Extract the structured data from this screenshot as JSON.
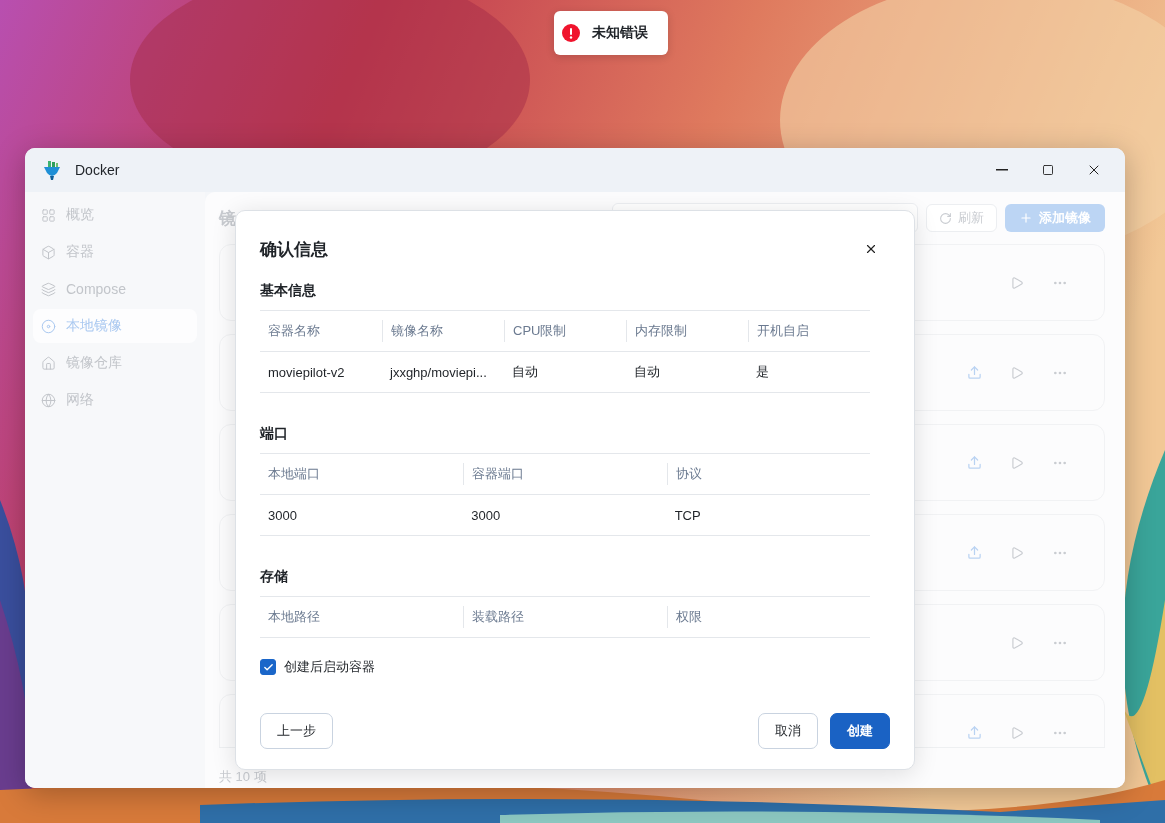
{
  "toast": {
    "kind": "error",
    "message": "未知错误"
  },
  "window": {
    "title": "Docker"
  },
  "sidebar": {
    "items": [
      {
        "label": "概览",
        "selected": false
      },
      {
        "label": "容器",
        "selected": false
      },
      {
        "label": "Compose",
        "selected": false
      },
      {
        "label": "本地镜像",
        "selected": true
      },
      {
        "label": "镜像仓库",
        "selected": false
      },
      {
        "label": "网络",
        "selected": false
      }
    ]
  },
  "content": {
    "heading": "镜",
    "refresh_button": "刷新",
    "add_button": "添加镜像",
    "rows": [
      {
        "can_push": false
      },
      {
        "can_push": true
      },
      {
        "can_push": true
      },
      {
        "can_push": true
      },
      {
        "can_push": false
      },
      {
        "can_push": true
      }
    ],
    "footer": "共 10 项"
  },
  "dialog": {
    "title": "确认信息",
    "sections": [
      {
        "title": "基本信息",
        "columns": [
          "容器名称",
          "镜像名称",
          "CPU限制",
          "内存限制",
          "开机自启"
        ],
        "rows": [
          [
            "moviepilot-v2",
            "jxxghp/moviepi...",
            "自动",
            "自动",
            "是"
          ]
        ]
      },
      {
        "title": "端口",
        "columns": [
          "本地端口",
          "容器端口",
          "协议"
        ],
        "rows": [
          [
            "3000",
            "3000",
            "TCP"
          ]
        ]
      },
      {
        "title": "存储",
        "columns": [
          "本地路径",
          "装载路径",
          "权限"
        ]
      }
    ],
    "start_after_create": {
      "label": "创建后启动容器",
      "checked": true
    },
    "back_button": "上一步",
    "cancel_button": "取消",
    "create_button": "创建"
  }
}
